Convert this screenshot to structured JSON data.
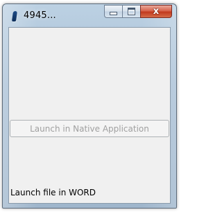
{
  "window": {
    "title": "4945...",
    "caption_buttons": {
      "minimize_icon": "minimize-icon",
      "maximize_icon": "maximize-icon",
      "close_icon": "close-icon",
      "close_glyph": "x"
    }
  },
  "main": {
    "launch_button_label": "Launch in Native Application",
    "launch_button_enabled": false,
    "status_text": "Launch file in WORD"
  },
  "colors": {
    "client_background": "#f0f0f0",
    "close_button_red": "#c8462a",
    "disabled_text": "#a0a0a0"
  }
}
